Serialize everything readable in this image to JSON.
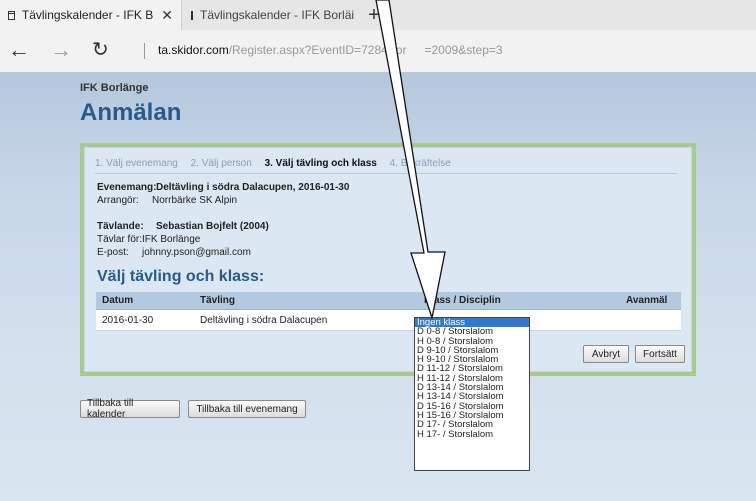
{
  "browser": {
    "tabs": [
      {
        "label": "Tävlingskalender - IFK B",
        "active": true
      },
      {
        "label": "Tävlingskalender - IFK Borläi",
        "active": false
      }
    ],
    "new_tab": "+",
    "close_glyph": "✕",
    "url_domain": "ta.skidor.com",
    "url_path": "/Register.aspx?EventID=7284&or",
    "url_tail": "=2009&step=3",
    "icons": {
      "back": "←",
      "forward": "→",
      "reload": "↻"
    }
  },
  "page": {
    "club": "IFK Borlänge",
    "heading": "Anmälan",
    "steps": [
      "1. Välj evenemang",
      "2. Välj person",
      "3. Välj tävling och klass",
      "4. Bekräftelse"
    ],
    "current_step": 2,
    "event": {
      "label": "Evenemang:",
      "value": "Deltävling i södra Dalacupen, 2016-01-30",
      "organizer_label": "Arrangör:",
      "organizer": "Norrbärke SK Alpin"
    },
    "competitor": {
      "label": "Tävlande:",
      "value": "Sebastian Bojfelt (2004)",
      "club_label": "Tävlar för:",
      "club": "IFK Borlänge",
      "email_label": "E-post:",
      "email": "johnny.pson@gmail.com"
    },
    "section_title": "Välj tävling och klass:",
    "table": {
      "headers": [
        "Datum",
        "Tävling",
        "Klass / Disciplin",
        "Avanmäl"
      ],
      "rows": [
        {
          "date": "2016-01-30",
          "race": "Deltävling i södra Dalacupen"
        }
      ]
    },
    "class_options": [
      "Ingen klass",
      "D 0-8 / Storslalom",
      "H 0-8 / Storslalom",
      "D 9-10 / Storslalom",
      "H 9-10 / Storslalom",
      "D 11-12 / Storslalom",
      "H 11-12 / Storslalom",
      "D 13-14 / Storslalom",
      "H 13-14 / Storslalom",
      "D 15-16 / Storslalom",
      "H 15-16 / Storslalom",
      "D 17- / Storslalom",
      "H 17- / Storslalom"
    ],
    "selected_option": "Ingen klass",
    "buttons": {
      "cancel": "Avbryt",
      "continue": "Fortsätt",
      "back_calendar": "Tillbaka till kalender",
      "back_event": "Tillbaka till evenemang"
    }
  },
  "colors": {
    "heading": "#2a5a8a",
    "frame": "#a7cb8a",
    "selection": "#2f7ad1"
  }
}
